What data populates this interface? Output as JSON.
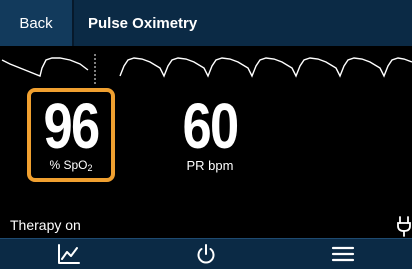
{
  "header": {
    "back_label": "Back",
    "title": "Pulse Oximetry"
  },
  "icons": {
    "trend": "trend-chart-icon",
    "power": "power-icon",
    "menu": "hamburger-menu-icon",
    "plug": "power-plug-icon"
  },
  "spo2": {
    "value": "96",
    "label_prefix": "% SpO",
    "label_sub": "2"
  },
  "pulse_rate": {
    "value": "60",
    "label": "PR bpm"
  },
  "status": {
    "text": "Therapy on"
  },
  "colors": {
    "highlight": "#f0a030",
    "header_bg": "#0b2a45",
    "back_bg": "#123a5c"
  }
}
